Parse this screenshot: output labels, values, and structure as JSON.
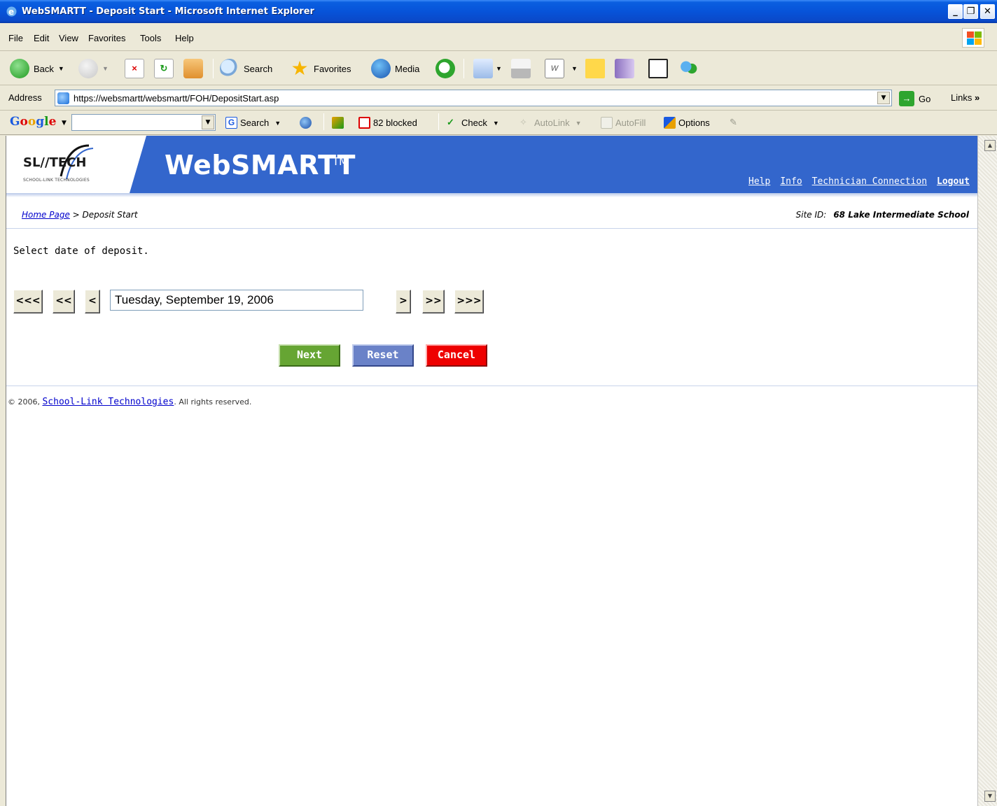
{
  "window": {
    "title": "WebSMARTT - Deposit Start - Microsoft Internet Explorer",
    "min_label": "_",
    "max_label": "❐",
    "close_label": "✕"
  },
  "menu": [
    "File",
    "Edit",
    "View",
    "Favorites",
    "Tools",
    "Help"
  ],
  "toolbar": {
    "back_label": "Back",
    "search_label": "Search",
    "favorites_label": "Favorites",
    "media_label": "Media"
  },
  "address": {
    "label": "Address",
    "url": "https://websmartt/websmartt/FOH/DepositStart.asp",
    "go_label": "Go",
    "links_label": "Links"
  },
  "googlebar": {
    "logo": "Google",
    "search_label": "Search",
    "blocked_label": "82 blocked",
    "check_label": "Check",
    "autolink_label": "AutoLink",
    "autofill_label": "AutoFill",
    "options_label": "Options"
  },
  "header": {
    "logo_text": "SL//TECH",
    "logo_sub": "SCHOOL-LINK TECHNOLOGIES",
    "app_title": "WebSMARTT",
    "tm": "TM",
    "links": {
      "help": "Help",
      "info": "Info",
      "technician": "Technician Connection",
      "logout": "Logout"
    }
  },
  "breadcrumb": {
    "home": "Home Page",
    "separator": " > ",
    "current": "Deposit Start"
  },
  "site": {
    "label": "Site ID:",
    "value": "68 Lake Intermediate School"
  },
  "instruction": "Select date of deposit.",
  "datepicker": {
    "prev_far": "<<<",
    "prev_more": "<<",
    "prev": "<",
    "value": "Tuesday, September 19, 2006",
    "next": ">",
    "next_more": ">>",
    "next_far": ">>>"
  },
  "actions": {
    "next": "Next",
    "reset": "Reset",
    "cancel": "Cancel"
  },
  "footer": {
    "prefix": "© 2006, ",
    "link": "School-Link Technologies",
    "suffix": ". All rights reserved."
  },
  "colors": {
    "header_blue": "#3366cc",
    "next_green": "#66a533",
    "reset_blue": "#6a82c8",
    "cancel_red": "#ee0000"
  }
}
